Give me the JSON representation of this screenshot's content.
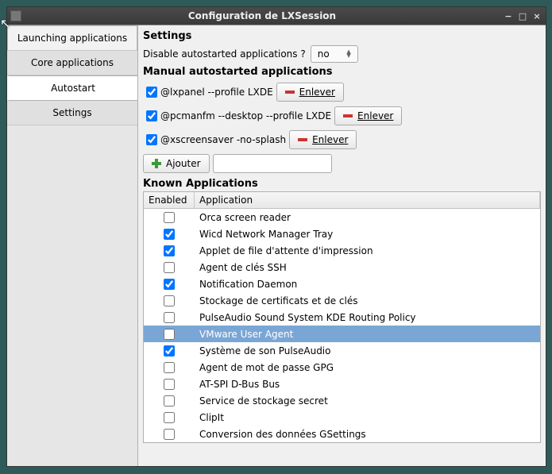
{
  "window": {
    "title": "Configuration de LXSession"
  },
  "sidebar": {
    "tabs": [
      {
        "label": "Launching applications"
      },
      {
        "label": "Core applications"
      },
      {
        "label": "Autostart"
      },
      {
        "label": "Settings"
      }
    ],
    "active_index": 2
  },
  "settings": {
    "heading": "Settings",
    "disable_label": "Disable autostarted applications ?",
    "disable_value": "no"
  },
  "manual": {
    "heading": "Manual autostarted applications",
    "remove_label": "Enlever",
    "add_label": "Ajouter",
    "add_value": "",
    "items": [
      {
        "checked": true,
        "command": "@lxpanel --profile LXDE"
      },
      {
        "checked": true,
        "command": "@pcmanfm --desktop --profile LXDE"
      },
      {
        "checked": true,
        "command": "@xscreensaver -no-splash"
      }
    ]
  },
  "known": {
    "heading": "Known Applications",
    "col_enabled": "Enabled",
    "col_application": "Application",
    "selected_index": 7,
    "rows": [
      {
        "enabled": false,
        "name": "Orca screen reader"
      },
      {
        "enabled": true,
        "name": "Wicd Network Manager Tray"
      },
      {
        "enabled": true,
        "name": "Applet de file d'attente d'impression"
      },
      {
        "enabled": false,
        "name": "Agent de clés SSH"
      },
      {
        "enabled": true,
        "name": "Notification Daemon"
      },
      {
        "enabled": false,
        "name": "Stockage de certificats et de clés"
      },
      {
        "enabled": false,
        "name": "PulseAudio Sound System KDE Routing Policy"
      },
      {
        "enabled": false,
        "name": "VMware User Agent"
      },
      {
        "enabled": true,
        "name": "Système de son PulseAudio"
      },
      {
        "enabled": false,
        "name": "Agent de mot de passe GPG"
      },
      {
        "enabled": false,
        "name": "AT-SPI D-Bus Bus"
      },
      {
        "enabled": false,
        "name": "Service de stockage secret"
      },
      {
        "enabled": false,
        "name": "ClipIt"
      },
      {
        "enabled": false,
        "name": "Conversion des données GSettings"
      }
    ]
  }
}
